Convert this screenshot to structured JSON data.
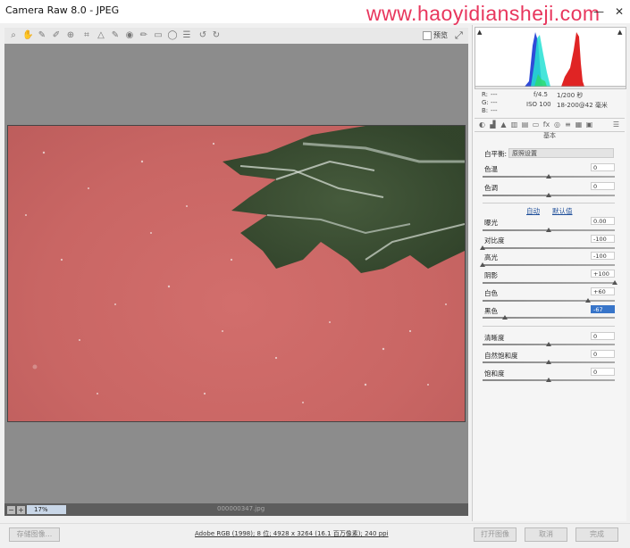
{
  "window": {
    "title": "Camera Raw 8.0 - JPEG",
    "watermark": "www.haoyidiansheji.com",
    "controls": {
      "minimize": "—",
      "close": "✕"
    }
  },
  "toolbar": {
    "tools": [
      "zoom-icon",
      "hand-icon",
      "white-balance-icon",
      "color-sampler-icon",
      "targeted-adjust-icon",
      "crop-icon",
      "straighten-icon",
      "spot-removal-icon",
      "red-eye-icon",
      "adjustment-brush-icon",
      "graduated-filter-icon",
      "radial-filter-icon",
      "preferences-icon",
      "rotate-ccw-icon",
      "rotate-cw-icon"
    ],
    "preview_label": "预览",
    "preview_checked": false
  },
  "image": {
    "filename": "000000347.jpg"
  },
  "bottom_bar": {
    "zoom_value": "17%"
  },
  "histogram": {
    "camera_info": {
      "r_label": "R:",
      "g_label": "G:",
      "b_label": "B:",
      "r_value": "---",
      "g_value": "---",
      "b_value": "---",
      "aperture": "f/4.5",
      "shutter": "1/200 秒",
      "iso": "ISO 100",
      "lens": "18-200@42 毫米"
    }
  },
  "panel": {
    "section_title": "基本",
    "white_balance": {
      "label": "白平衡:",
      "value": "原照设置"
    },
    "temperature": {
      "label": "色温",
      "value": "0",
      "slider": 0.5
    },
    "tint": {
      "label": "色调",
      "value": "0",
      "slider": 0.5
    },
    "auto_label": "自动",
    "default_label": "默认值",
    "exposure": {
      "label": "曝光",
      "value": "0.00",
      "slider": 0.5
    },
    "contrast": {
      "label": "对比度",
      "value": "-100",
      "slider": 0.0
    },
    "highlights": {
      "label": "高光",
      "value": "-100",
      "slider": 0.0
    },
    "shadows": {
      "label": "阴影",
      "value": "+100",
      "slider": 1.0
    },
    "whites": {
      "label": "白色",
      "value": "+60",
      "slider": 0.8
    },
    "blacks": {
      "label": "黑色",
      "value": "-67",
      "slider": 0.17
    },
    "clarity": {
      "label": "清晰度",
      "value": "0",
      "slider": 0.5
    },
    "vibrance": {
      "label": "自然饱和度",
      "value": "0",
      "slider": 0.5
    },
    "saturation": {
      "label": "饱和度",
      "value": "0",
      "slider": 0.5
    }
  },
  "footer": {
    "save_image": "存储图像...",
    "info": "Adobe RGB (1998); 8 位; 4928 x 3264 (16.1 百万像素); 240 ppi",
    "open_image": "打开图像",
    "cancel": "取消",
    "done": "完成"
  }
}
